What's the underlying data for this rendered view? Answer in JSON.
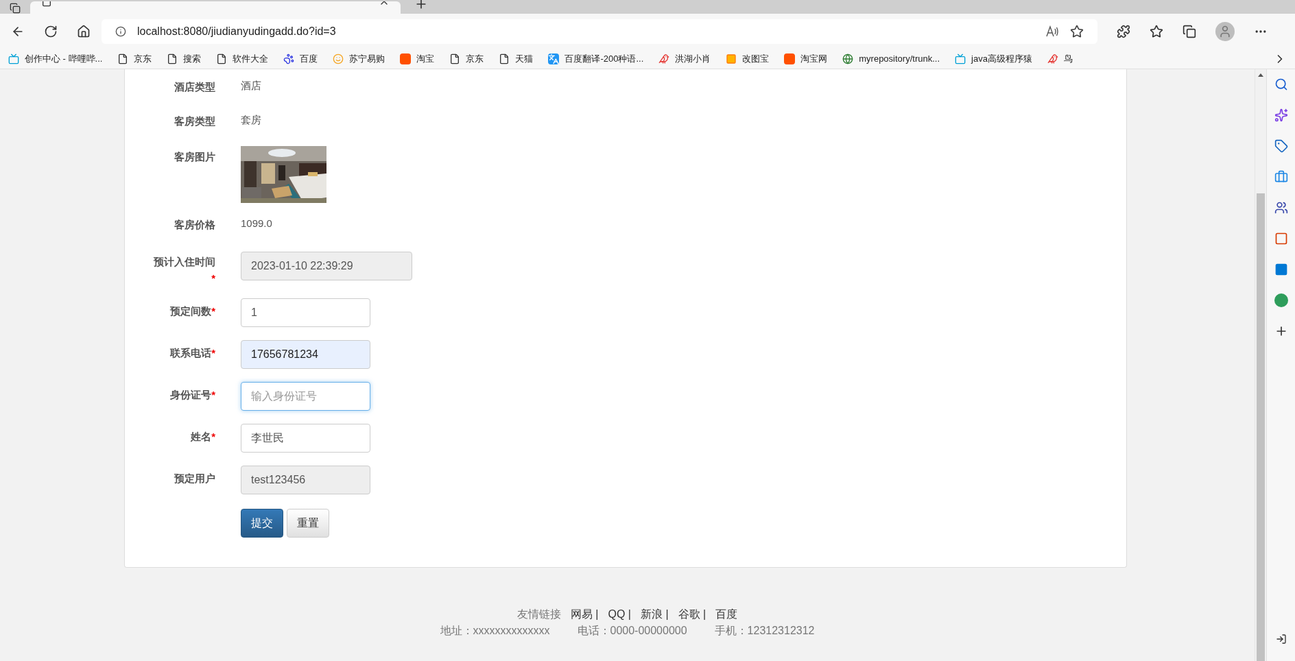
{
  "browser": {
    "url": "localhost:8080/jiudianyudingadd.do?id=3",
    "bookmarks": [
      {
        "label": "创作中心 - 哔哩哔...",
        "kind": "tv"
      },
      {
        "label": "京东",
        "kind": "page"
      },
      {
        "label": "搜索",
        "kind": "page"
      },
      {
        "label": "软件大全",
        "kind": "page"
      },
      {
        "label": "百度",
        "kind": "paw"
      },
      {
        "label": "苏宁易购",
        "kind": "lion"
      },
      {
        "label": "淘宝",
        "kind": "tao"
      },
      {
        "label": "京东",
        "kind": "page"
      },
      {
        "label": "天猫",
        "kind": "page"
      },
      {
        "label": "百度翻译-200种语...",
        "kind": "translate"
      },
      {
        "label": "洪湖小肖",
        "kind": "bird"
      },
      {
        "label": "改图宝",
        "kind": "square"
      },
      {
        "label": "淘宝网",
        "kind": "tao"
      },
      {
        "label": "myrepository/trunk...",
        "kind": "globe"
      },
      {
        "label": "java高级程序猿",
        "kind": "tv"
      },
      {
        "label": "鸟",
        "kind": "bird"
      }
    ]
  },
  "form": {
    "fields": [
      {
        "kind": "text",
        "label": "酒店类型",
        "value": "酒店"
      },
      {
        "kind": "text",
        "label": "客房类型",
        "value": "套房"
      },
      {
        "label": "客房图片"
      },
      {
        "kind": "text",
        "label": "客房价格",
        "value": "1099.0"
      },
      {
        "kind": "datetime",
        "label": "预计入住时间",
        "required_mark": "*",
        "disabled": true,
        "focused": false,
        "value": "2023-01-10 22:39:29"
      },
      {
        "kind": "input",
        "label": "预定间数",
        "required_mark": "*",
        "disabled": false,
        "autofilled": false,
        "focused": false,
        "value": "1"
      },
      {
        "kind": "input",
        "label": "联系电话",
        "required_mark": "*",
        "disabled": false,
        "autofilled": true,
        "focused": false,
        "value": "17656781234"
      },
      {
        "kind": "input",
        "label": "身份证号",
        "required_mark": "*",
        "disabled": false,
        "autofilled": false,
        "focused": true,
        "placeholder": "输入身份证号"
      },
      {
        "kind": "input",
        "label": "姓名",
        "required_mark": "*",
        "disabled": false,
        "autofilled": false,
        "focused": false,
        "value": "李世民"
      },
      {
        "kind": "input",
        "label": "预定用户",
        "disabled": true,
        "focused": false,
        "value": "test123456"
      }
    ],
    "buttons": [
      {
        "label": "提交",
        "kind": "primary"
      },
      {
        "label": "重置",
        "kind": "default"
      }
    ]
  },
  "footer": {
    "links_label": "友情链接",
    "links": [
      "网易 |",
      "QQ |",
      "新浪 |",
      "谷歌 |",
      "百度"
    ],
    "contacts": [
      "地址：xxxxxxxxxxxxxx",
      "电话：0000-00000000",
      "手机：12312312312"
    ]
  }
}
